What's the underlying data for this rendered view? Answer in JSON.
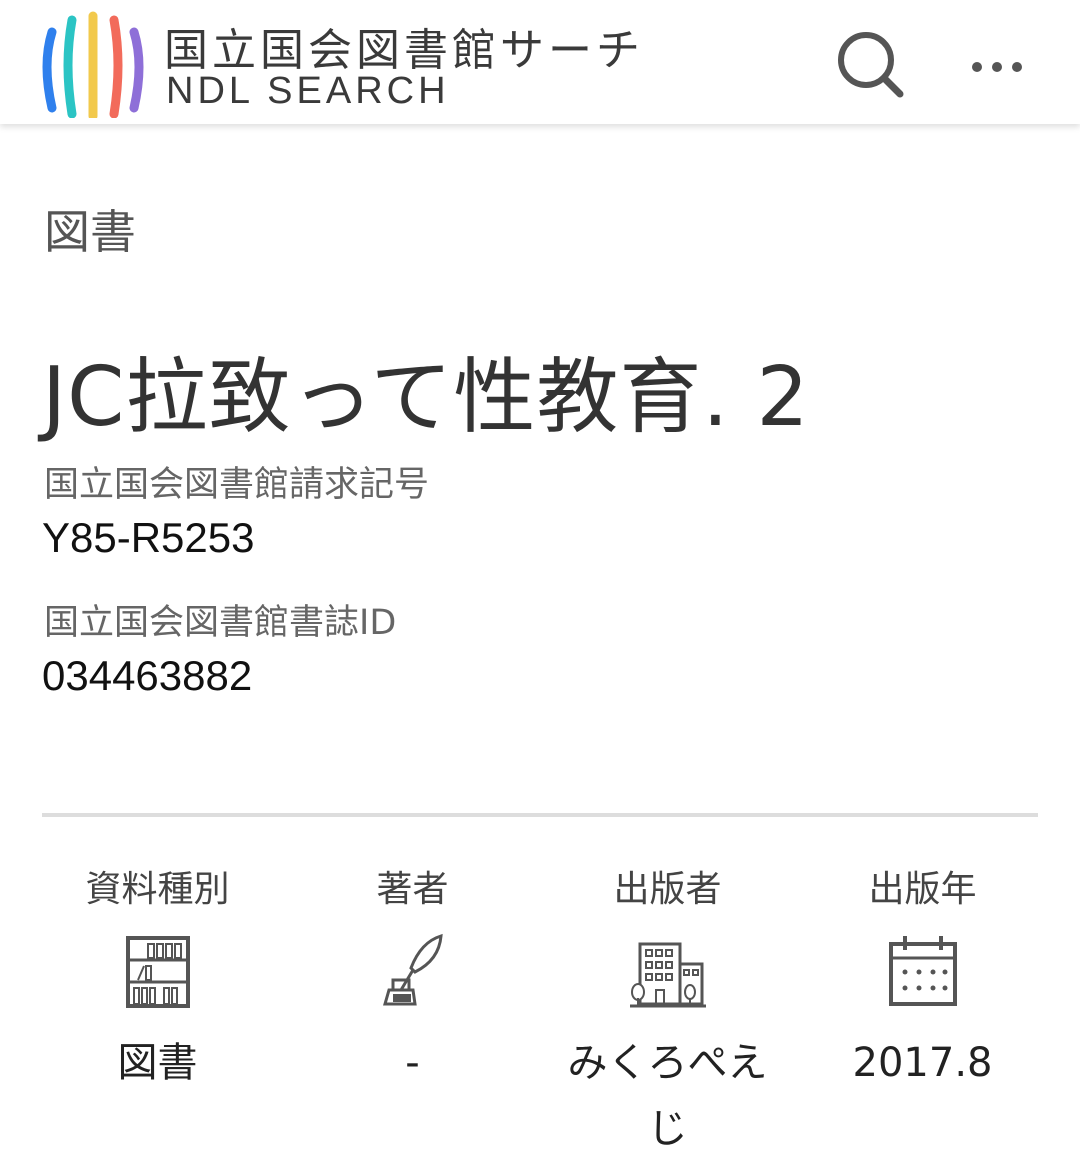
{
  "header": {
    "logo_jp": "国立国会図書館サーチ",
    "logo_en": "NDL SEARCH",
    "logo_colors": [
      "#2f80ed",
      "#2bc4c4",
      "#f2c94c",
      "#f26b5b",
      "#8e6fd8"
    ],
    "search_icon": "search-icon",
    "more_icon": "more-icon"
  },
  "record": {
    "category": "図書",
    "title": "JC拉致って性教育. 2",
    "fields": [
      {
        "label": "国立国会図書館請求記号",
        "value": "Y85-R5253"
      },
      {
        "label": "国立国会図書館書誌ID",
        "value": "034463882"
      }
    ]
  },
  "summary": [
    {
      "label": "資料種別",
      "icon": "bookshelf-icon",
      "value": "図書"
    },
    {
      "label": "著者",
      "icon": "quill-pen-icon",
      "value": "-"
    },
    {
      "label": "出版者",
      "icon": "buildings-icon",
      "value": "みくろぺえじ"
    },
    {
      "label": "出版年",
      "icon": "calendar-icon",
      "value": "2017.8"
    }
  ]
}
